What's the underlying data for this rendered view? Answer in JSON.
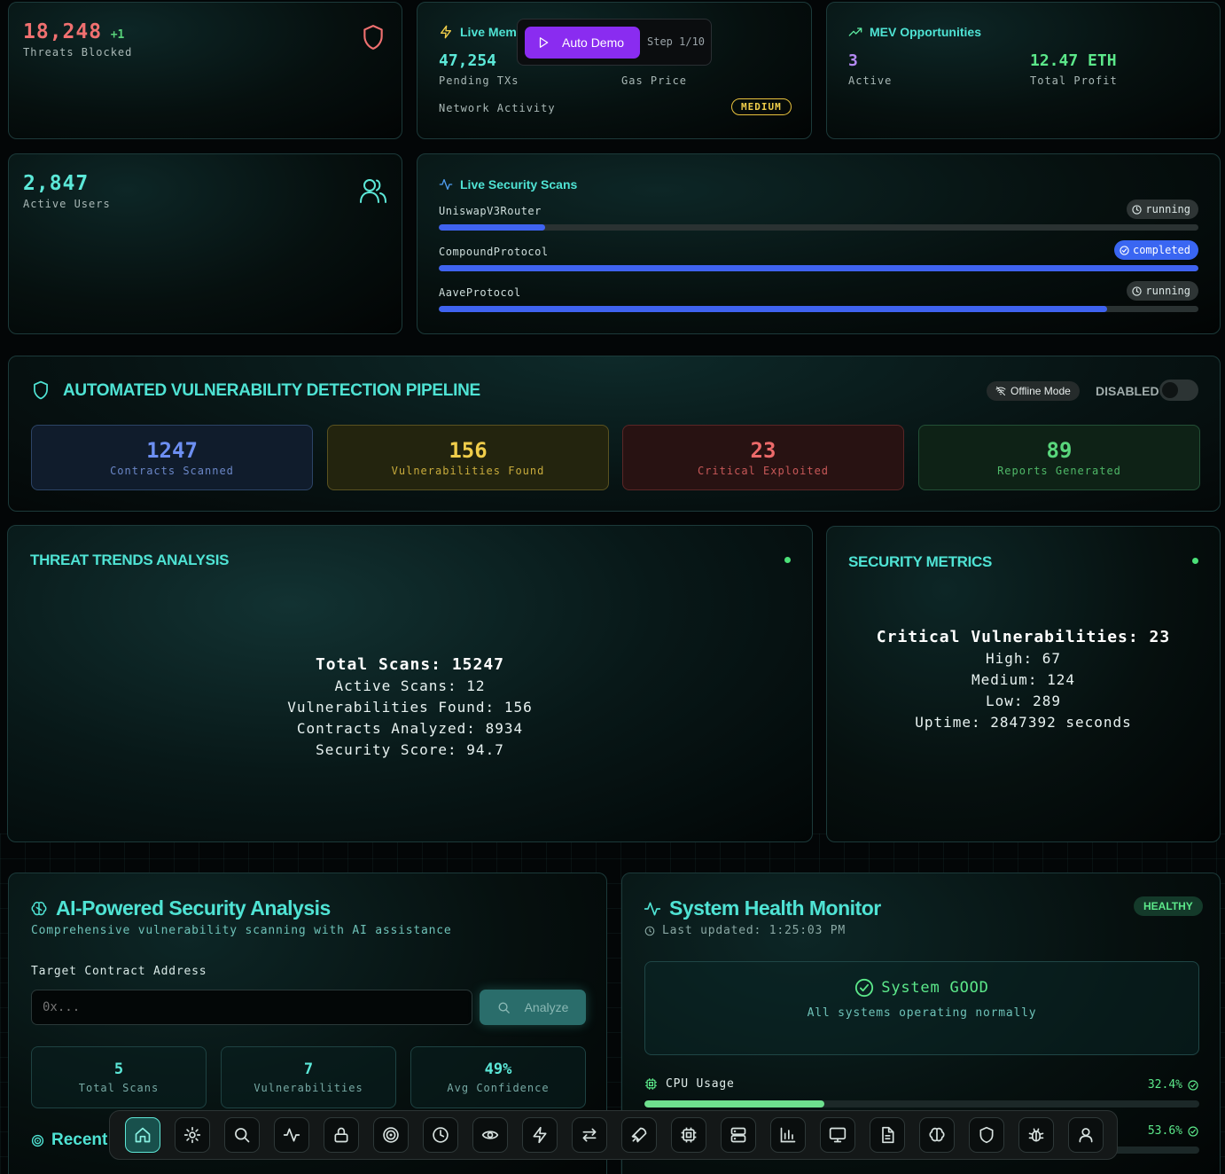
{
  "threats": {
    "value": "18,248",
    "delta": "+1",
    "label": "Threats Blocked"
  },
  "mempool": {
    "title": "Live Mem",
    "pending_value": "47,254",
    "pending_label": "Pending TXs",
    "gas_label": "Gas Price",
    "activity_label": "Network Activity",
    "activity_badge": "MEDIUM"
  },
  "demo": {
    "button_label": "Auto Demo",
    "step": "Step 1/10"
  },
  "mev": {
    "title": "MEV Opportunities",
    "active_value": "3",
    "active_label": "Active",
    "profit_value": "12.47 ETH",
    "profit_label": "Total Profit"
  },
  "users": {
    "value": "2,847",
    "label": "Active Users"
  },
  "scans": {
    "title": "Live Security Scans",
    "items": [
      {
        "name": "UniswapV3Router",
        "status": "running",
        "progress": 0.14
      },
      {
        "name": "CompoundProtocol",
        "status": "completed",
        "progress": 1.0
      },
      {
        "name": "AaveProtocol",
        "status": "running",
        "progress": 0.88
      }
    ]
  },
  "pipeline": {
    "title": "AUTOMATED VULNERABILITY DETECTION PIPELINE",
    "offline_label": "Offline Mode",
    "toggle_label": "DISABLED",
    "stats": [
      {
        "value": "1247",
        "label": "Contracts Scanned",
        "color": "#6d8ff2"
      },
      {
        "value": "156",
        "label": "Vulnerabilities Found",
        "color": "#f0cd4a"
      },
      {
        "value": "23",
        "label": "Critical Exploited",
        "color": "#ec6a6a"
      },
      {
        "value": "89",
        "label": "Reports Generated",
        "color": "#59d67c"
      }
    ]
  },
  "threat_trends": {
    "title": "THREAT TRENDS ANALYSIS",
    "lines": [
      "Total Scans: 15247",
      "Active Scans: 12",
      "Vulnerabilities Found: 156",
      "Contracts Analyzed: 8934",
      "Security Score: 94.7"
    ]
  },
  "security_metrics": {
    "title": "SECURITY METRICS",
    "lines": [
      "Critical Vulnerabilities: 23",
      "High: 67",
      "Medium: 124",
      "Low: 289",
      "Uptime: 2847392 seconds"
    ]
  },
  "ai": {
    "title": "AI-Powered Security Analysis",
    "subtitle": "Comprehensive vulnerability scanning with AI assistance",
    "field_label": "Target Contract Address",
    "placeholder": "0x...",
    "analyze_label": "Analyze",
    "stats": [
      {
        "value": "5",
        "label": "Total Scans"
      },
      {
        "value": "7",
        "label": "Vulnerabilities"
      },
      {
        "value": "49%",
        "label": "Avg Confidence"
      }
    ],
    "recent_label": "Recent"
  },
  "health": {
    "title": "System Health Monitor",
    "badge": "HEALTHY",
    "updated": "Last updated: 1:25:03 PM",
    "status_title": "System GOOD",
    "status_sub": "All systems operating normally",
    "metrics": [
      {
        "name": "CPU Usage",
        "value": "32.4%",
        "level": 0.324
      },
      {
        "name": "",
        "value": "53.6%",
        "level": 0.536
      }
    ]
  },
  "dock": {
    "icons": [
      "home-icon",
      "settings-icon",
      "search-icon",
      "activity-icon",
      "lock-icon",
      "target-icon",
      "clock-icon",
      "eye-icon",
      "zap-icon",
      "swap-icon",
      "rocket-icon",
      "cpu-icon",
      "server-icon",
      "bar-chart-icon",
      "monitor-icon",
      "file-icon",
      "brain-icon",
      "shield-icon",
      "bug-icon",
      "user-icon"
    ],
    "active_index": 0
  }
}
